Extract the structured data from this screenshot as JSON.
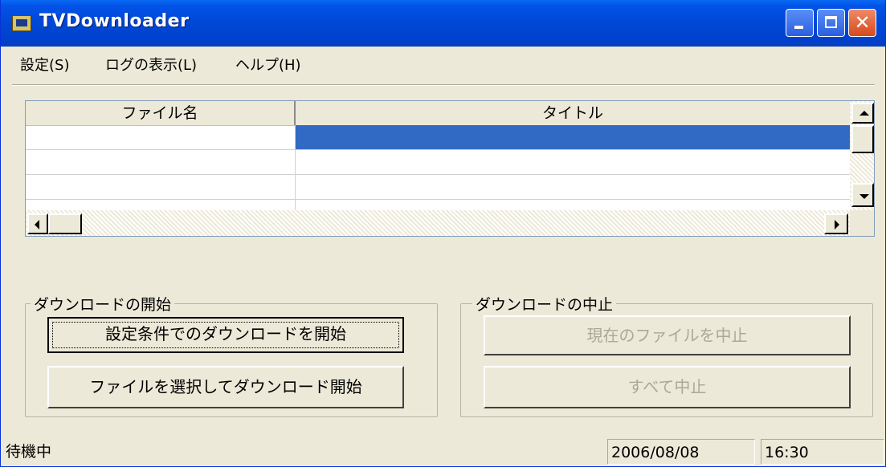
{
  "window": {
    "title": "TVDownloader"
  },
  "menu": {
    "items": [
      "設定(S)",
      "ログの表示(L)",
      "ヘルプ(H)"
    ]
  },
  "list": {
    "columns": [
      "ファイル名",
      "タイトル"
    ],
    "rows": []
  },
  "group_start": {
    "label": "ダウンロードの開始",
    "button_conditions": "設定条件でのダウンロードを開始",
    "button_select_file": "ファイルを選択してダウンロード開始"
  },
  "group_stop": {
    "label": "ダウンロードの中止",
    "button_stop_current": "現在のファイルを中止",
    "button_stop_all": "すべて中止"
  },
  "status": {
    "message": "待機中",
    "date": "2006/08/08",
    "time": "16:30"
  }
}
